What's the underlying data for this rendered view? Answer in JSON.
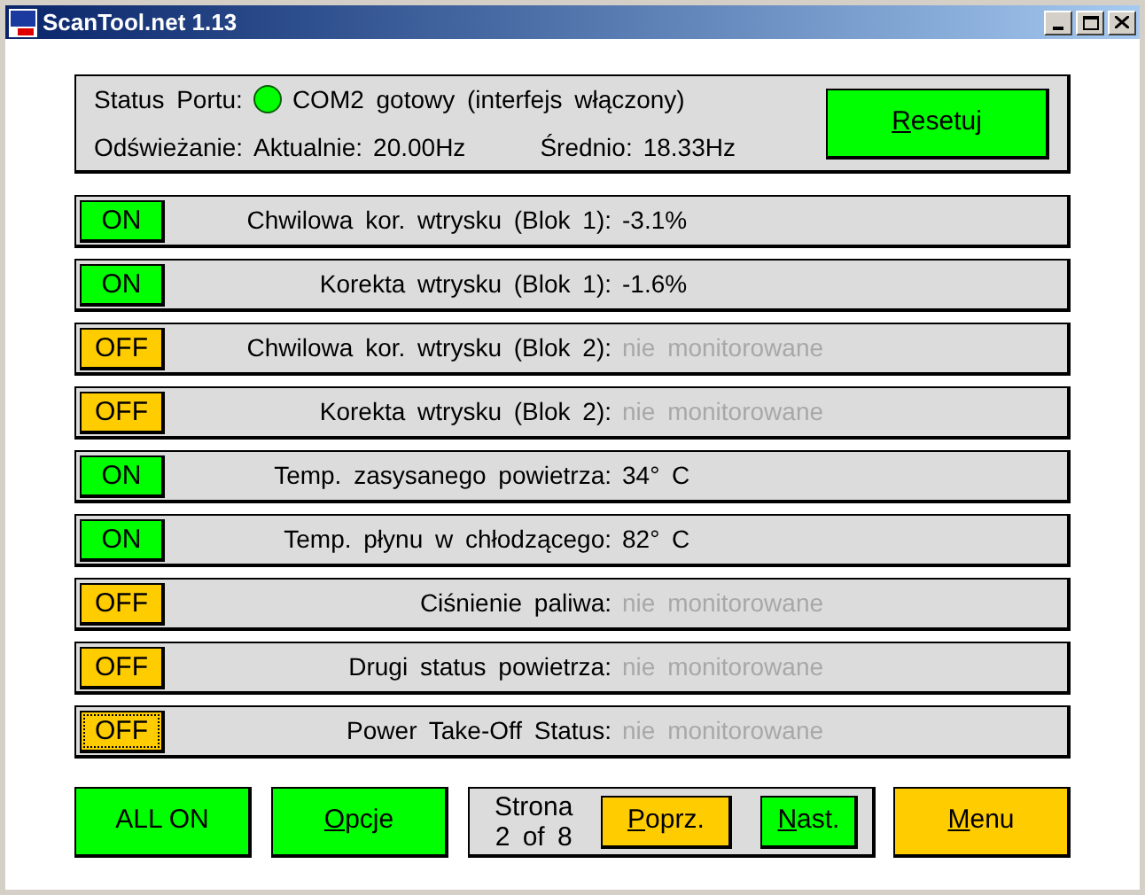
{
  "window": {
    "title": "ScanTool.net 1.13"
  },
  "status": {
    "port_label": "Status Portu:",
    "port_ok": true,
    "port_text": "COM2 gotowy (interfejs włączony)",
    "refresh_label": "Odświeżanie:",
    "current_label": "Aktualnie:",
    "current_value": "20.00Hz",
    "average_label": "Średnio:",
    "average_value": "18.33Hz",
    "reset_button": "Resetuj"
  },
  "sensors": [
    {
      "toggle": "ON",
      "on": true,
      "focused": false,
      "label": "Chwilowa kor. wtrysku (Blok 1):",
      "value": "-3.1%",
      "monitored": true
    },
    {
      "toggle": "ON",
      "on": true,
      "focused": false,
      "label": "Korekta wtrysku (Blok 1):",
      "value": "-1.6%",
      "monitored": true
    },
    {
      "toggle": "OFF",
      "on": false,
      "focused": false,
      "label": "Chwilowa kor. wtrysku (Blok 2):",
      "value": "nie monitorowane",
      "monitored": false
    },
    {
      "toggle": "OFF",
      "on": false,
      "focused": false,
      "label": "Korekta wtrysku (Blok 2):",
      "value": "nie monitorowane",
      "monitored": false
    },
    {
      "toggle": "ON",
      "on": true,
      "focused": false,
      "label": "Temp. zasysanego powietrza:",
      "value": "34° C",
      "monitored": true
    },
    {
      "toggle": "ON",
      "on": true,
      "focused": false,
      "label": "Temp. płynu w chłodzącego:",
      "value": "82° C",
      "monitored": true
    },
    {
      "toggle": "OFF",
      "on": false,
      "focused": false,
      "label": "Ciśnienie paliwa:",
      "value": "nie monitorowane",
      "monitored": false
    },
    {
      "toggle": "OFF",
      "on": false,
      "focused": false,
      "label": "Drugi status powietrza:",
      "value": "nie monitorowane",
      "monitored": false
    },
    {
      "toggle": "OFF",
      "on": false,
      "focused": true,
      "label": "Power Take-Off Status:",
      "value": "nie monitorowane",
      "monitored": false
    }
  ],
  "footer": {
    "all_on_button": "ALL ON",
    "options_button": "Opcje",
    "page_label": "Strona",
    "page_value": "2 of 8",
    "prev_button": "Poprz.",
    "next_button": "Nast.",
    "menu_button": "Menu"
  }
}
